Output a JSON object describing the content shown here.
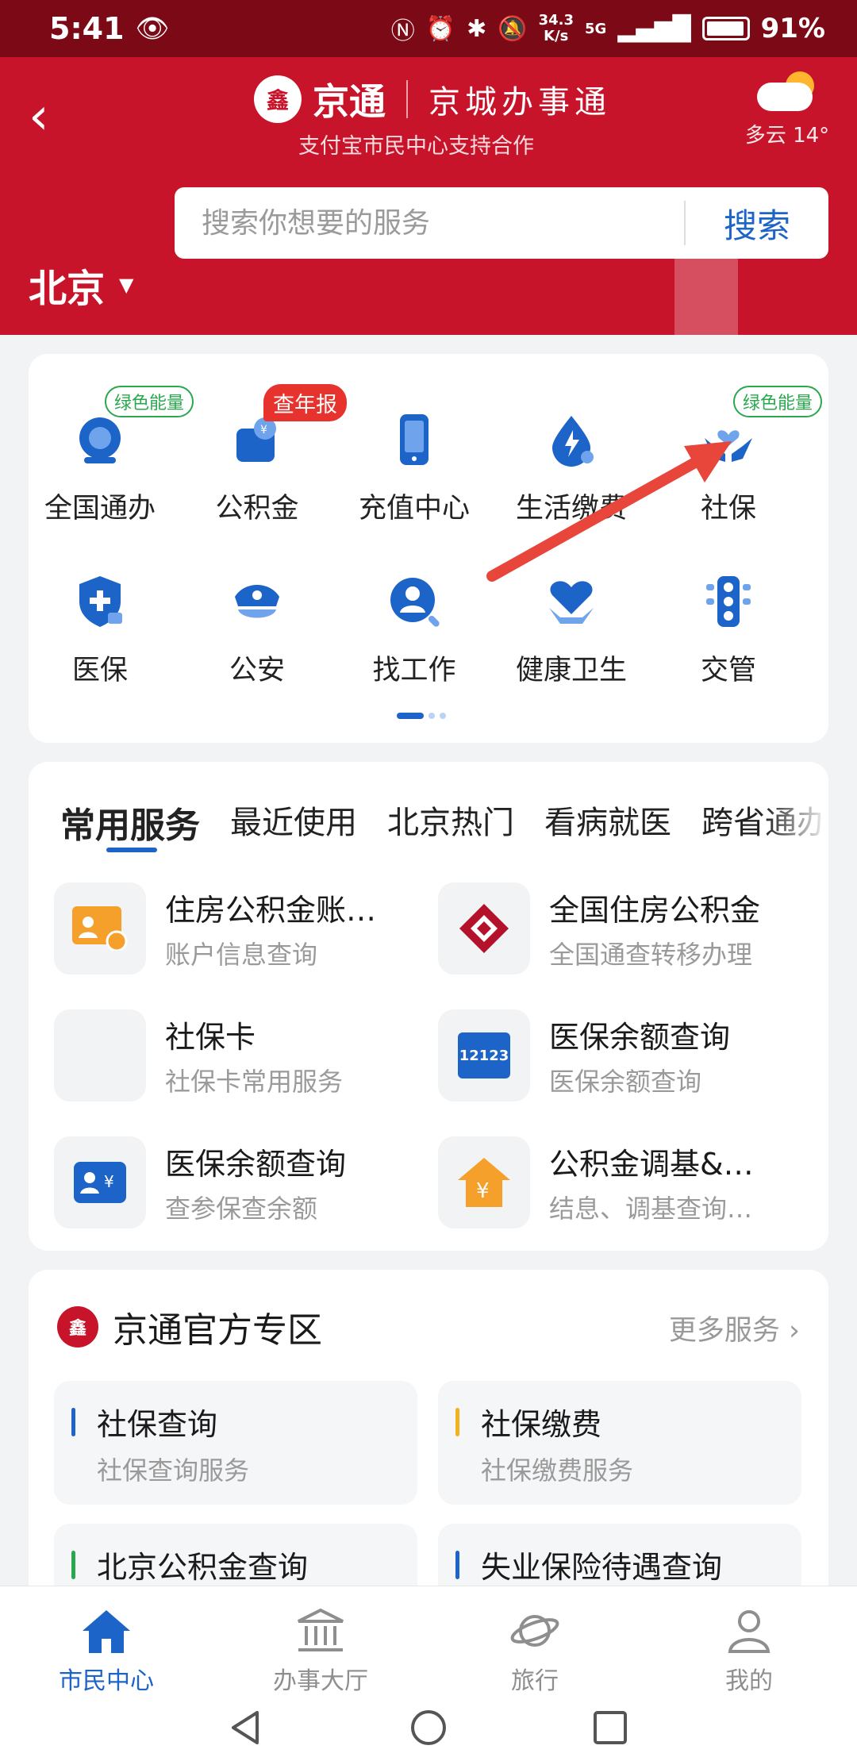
{
  "status": {
    "time": "5:41",
    "speed_top": "34.3",
    "speed_bottom": "K/s",
    "network": "5G",
    "battery": "91%"
  },
  "header": {
    "brand": "京通",
    "brand_script": "京城办事通",
    "subtitle": "支付宝市民中心支持合作",
    "weather": "多云 14°",
    "city": "北京"
  },
  "search": {
    "placeholder": "搜索你想要的服务",
    "button": "搜索"
  },
  "grid": {
    "row1": [
      {
        "label": "全国通办",
        "badge": "绿色能量"
      },
      {
        "label": "公积金",
        "badge": "查年报"
      },
      {
        "label": "充值中心"
      },
      {
        "label": "生活缴费"
      },
      {
        "label": "社保",
        "badge": "绿色能量"
      }
    ],
    "row2": [
      {
        "label": "医保"
      },
      {
        "label": "公安"
      },
      {
        "label": "找工作"
      },
      {
        "label": "健康卫生"
      },
      {
        "label": "交管"
      }
    ]
  },
  "services": {
    "tabs": [
      "常用服务",
      "最近使用",
      "北京热门",
      "看病就医",
      "跨省通办"
    ],
    "items": [
      {
        "title": "住房公积金账…",
        "sub": "账户信息查询"
      },
      {
        "title": "全国住房公积金",
        "sub": "全国通查转移办理"
      },
      {
        "title": "社保卡",
        "sub": "社保卡常用服务"
      },
      {
        "title": "医保余额查询",
        "sub": "医保余额查询",
        "icon_text": "12123"
      },
      {
        "title": "医保余额查询",
        "sub": "查参保查余额"
      },
      {
        "title": "公积金调基&…",
        "sub": "结息、调基查询…"
      }
    ]
  },
  "official": {
    "title": "京通官方专区",
    "more": "更多服务",
    "items": [
      {
        "title": "社保查询",
        "sub": "社保查询服务",
        "color": "#1c64c8"
      },
      {
        "title": "社保缴费",
        "sub": "社保缴费服务",
        "color": "#f2b21c"
      },
      {
        "title": "北京公积金查询",
        "color": "#2aa84f"
      },
      {
        "title": "失业保险待遇查询",
        "color": "#1c64c8"
      }
    ]
  },
  "nav": {
    "items": [
      "市民中心",
      "办事大厅",
      "旅行",
      "我的"
    ]
  },
  "colors": {
    "brand_red": "#c8142a",
    "accent_blue": "#1c64c8",
    "green_badge": "#2aa84f",
    "red_badge": "#e8322d"
  }
}
